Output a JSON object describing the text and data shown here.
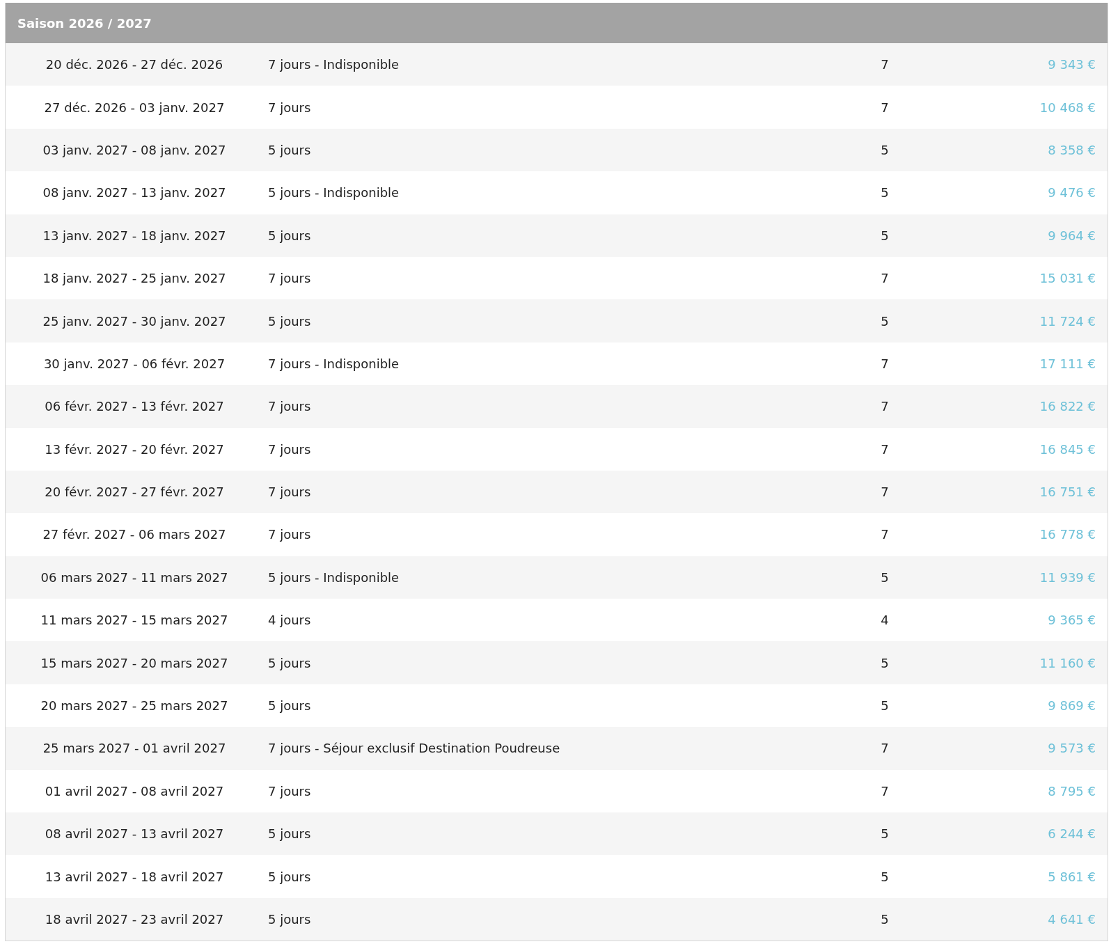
{
  "season_title": "Saison 2026 / 2027",
  "rows": [
    {
      "dates": "20 déc. 2026 - 27 déc. 2026",
      "description": "7 jours - Indisponible",
      "count": "7",
      "price": "9 343 €"
    },
    {
      "dates": "27 déc. 2026 - 03 janv. 2027",
      "description": "7 jours",
      "count": "7",
      "price": "10 468 €"
    },
    {
      "dates": "03 janv. 2027 - 08 janv. 2027",
      "description": "5 jours",
      "count": "5",
      "price": "8 358 €"
    },
    {
      "dates": "08 janv. 2027 - 13 janv. 2027",
      "description": "5 jours - Indisponible",
      "count": "5",
      "price": "9 476 €"
    },
    {
      "dates": "13 janv. 2027 - 18 janv. 2027",
      "description": "5 jours",
      "count": "5",
      "price": "9 964 €"
    },
    {
      "dates": "18 janv. 2027 - 25 janv. 2027",
      "description": "7 jours",
      "count": "7",
      "price": "15 031 €"
    },
    {
      "dates": "25 janv. 2027 - 30 janv. 2027",
      "description": "5 jours",
      "count": "5",
      "price": "11 724 €"
    },
    {
      "dates": "30 janv. 2027 - 06 févr. 2027",
      "description": "7 jours - Indisponible",
      "count": "7",
      "price": "17 111 €"
    },
    {
      "dates": "06 févr. 2027 - 13 févr. 2027",
      "description": "7 jours",
      "count": "7",
      "price": "16 822 €"
    },
    {
      "dates": "13 févr. 2027 - 20 févr. 2027",
      "description": "7 jours",
      "count": "7",
      "price": "16 845 €"
    },
    {
      "dates": "20 févr. 2027 - 27 févr. 2027",
      "description": "7 jours",
      "count": "7",
      "price": "16 751 €"
    },
    {
      "dates": "27 févr. 2027 - 06 mars 2027",
      "description": "7 jours",
      "count": "7",
      "price": "16 778 €"
    },
    {
      "dates": "06 mars 2027 - 11 mars 2027",
      "description": "5 jours - Indisponible",
      "count": "5",
      "price": "11 939 €"
    },
    {
      "dates": "11 mars 2027 - 15 mars 2027",
      "description": "4 jours",
      "count": "4",
      "price": "9 365 €"
    },
    {
      "dates": "15 mars 2027 - 20 mars 2027",
      "description": "5 jours",
      "count": "5",
      "price": "11 160 €"
    },
    {
      "dates": "20 mars 2027 - 25 mars 2027",
      "description": "5 jours",
      "count": "5",
      "price": "9 869 €"
    },
    {
      "dates": "25 mars 2027 - 01 avril 2027",
      "description": "7 jours - Séjour exclusif Destination Poudreuse",
      "count": "7",
      "price": "9 573 €"
    },
    {
      "dates": "01 avril 2027 - 08 avril 2027",
      "description": "7 jours",
      "count": "7",
      "price": "8 795 €"
    },
    {
      "dates": "08 avril 2027 - 13 avril 2027",
      "description": "5 jours",
      "count": "5",
      "price": "6 244 €"
    },
    {
      "dates": "13 avril 2027 - 18 avril 2027",
      "description": "5 jours",
      "count": "5",
      "price": "5 861 €"
    },
    {
      "dates": "18 avril 2027 - 23 avril 2027",
      "description": "5 jours",
      "count": "5",
      "price": "4 641 €"
    }
  ]
}
